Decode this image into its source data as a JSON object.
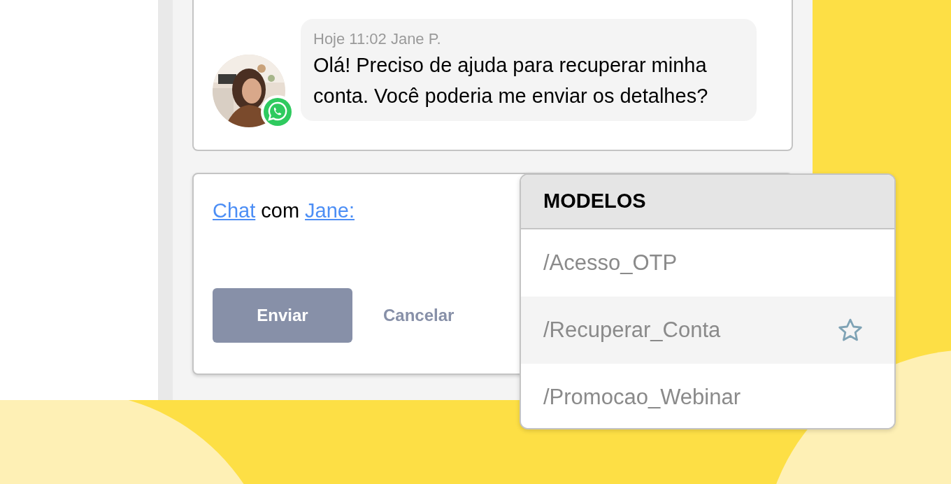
{
  "message": {
    "meta": "Hoje 11:02 Jane P.",
    "text": "Olá! Preciso de ajuda para recuperar minha conta. Você poderia me enviar os detalhes?"
  },
  "composer": {
    "parts": [
      {
        "text": "Chat",
        "kind": "link"
      },
      {
        "text": "com",
        "kind": "plain"
      },
      {
        "text": "Jane:",
        "kind": "link"
      }
    ],
    "buttons": [
      {
        "label": "Enviar",
        "kind": "primary"
      },
      {
        "label": "Cancelar",
        "kind": "text"
      }
    ]
  },
  "templates": {
    "title": "MODELOS",
    "items": [
      {
        "label": "/Acesso_OTP",
        "selected": false
      },
      {
        "label": "/Recuperar_Conta",
        "selected": true
      },
      {
        "label": "/Promocao_Webinar",
        "selected": false
      }
    ]
  }
}
